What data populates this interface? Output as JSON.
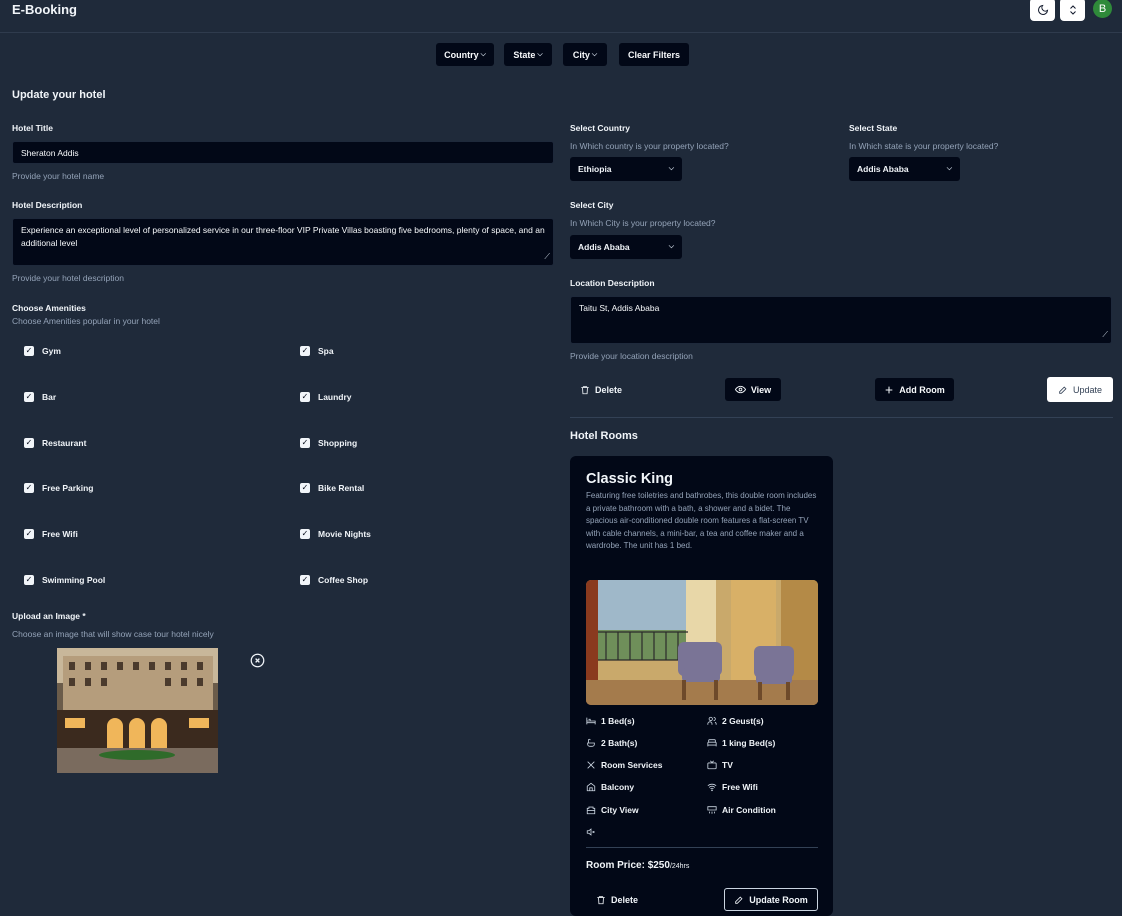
{
  "app": {
    "title": "E-Booking",
    "avatar_initial": "B"
  },
  "filters": {
    "country": "Country",
    "state": "State",
    "city": "City",
    "clear": "Clear Filters"
  },
  "form": {
    "heading": "Update your hotel",
    "title_label": "Hotel Title",
    "title_value": "Sheraton Addis",
    "title_hint": "Provide your hotel name",
    "desc_label": "Hotel Description",
    "desc_value": "Experience an exceptional level of personalized service in our three-floor VIP Private Villas boasting five bedrooms, plenty of space, and an additional level",
    "desc_hint": "Provide your hotel description",
    "amenities_label": "Choose Amenities",
    "amenities_hint": "Choose Amenities popular in your hotel",
    "amenities": [
      {
        "label": "Gym",
        "checked": true
      },
      {
        "label": "Spa",
        "checked": true
      },
      {
        "label": "Bar",
        "checked": true
      },
      {
        "label": "Laundry",
        "checked": true
      },
      {
        "label": "Restaurant",
        "checked": true
      },
      {
        "label": "Shopping",
        "checked": true
      },
      {
        "label": "Free Parking",
        "checked": true
      },
      {
        "label": "Bike Rental",
        "checked": true
      },
      {
        "label": "Free Wifi",
        "checked": true
      },
      {
        "label": "Movie Nights",
        "checked": true
      },
      {
        "label": "Swimming Pool",
        "checked": true
      },
      {
        "label": "Coffee Shop",
        "checked": true
      }
    ],
    "image_label": "Upload an Image *",
    "image_hint": "Choose an image that will show case tour hotel nicely",
    "country_label": "Select Country",
    "country_hint": "In Which country is your property located?",
    "country_value": "Ethiopia",
    "state_label": "Select State",
    "state_hint": "In Which state is your property located?",
    "state_value": "Addis Ababa",
    "city_label": "Select City",
    "city_hint": "In Which City is your property located?",
    "city_value": "Addis Ababa",
    "location_label": "Location Description",
    "location_value": "Taitu St, Addis Ababa",
    "location_hint": "Provide your location description"
  },
  "actions": {
    "delete": "Delete",
    "view": "View",
    "add_room": "Add Room",
    "update": "Update"
  },
  "rooms": {
    "heading": "Hotel Rooms",
    "card": {
      "title": "Classic King",
      "description": "Featuring free toiletries and bathrobes, this double room includes a private bathroom with a bath, a shower and a bidet. The spacious air-conditioned double room features a flat-screen TV with cable channels, a mini-bar, a tea and coffee maker and a wardrobe. The unit has 1 bed.",
      "features": {
        "beds": "1 Bed(s)",
        "guests": "2 Geust(s)",
        "baths": "2 Bath(s)",
        "king_beds": "1 king Bed(s)",
        "room_services": "Room Services",
        "tv": "TV",
        "balcony": "Balcony",
        "wifi": "Free Wifi",
        "view": "City View",
        "ac": "Air Condition"
      },
      "price_label": "Room Price:",
      "price_value": "$250",
      "price_unit": "/24hrs",
      "delete": "Delete",
      "update": "Update Room"
    }
  }
}
